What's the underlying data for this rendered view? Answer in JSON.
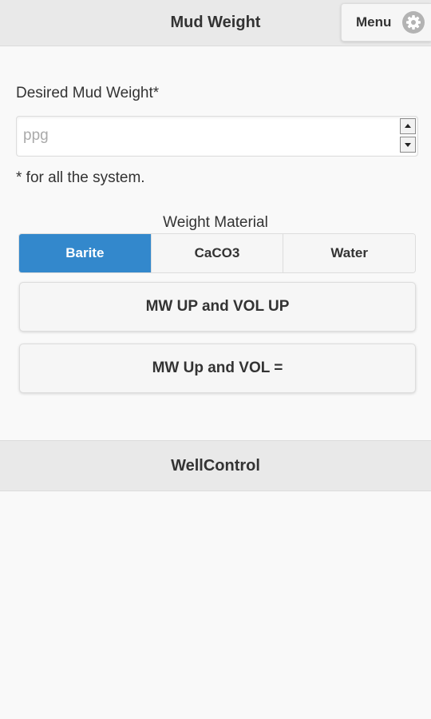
{
  "header": {
    "title": "Mud Weight",
    "menu_label": "Menu",
    "menu_icon": "gear-icon"
  },
  "form": {
    "field_label": "Desired Mud Weight*",
    "input_value": "",
    "input_placeholder": "ppg",
    "note": "* for all the system."
  },
  "weight_material": {
    "label": "Weight Material",
    "options": [
      "Barite",
      "CaCO3",
      "Water"
    ],
    "selected": "Barite"
  },
  "actions": {
    "mw_up_vol_up": "MW UP and VOL UP",
    "mw_up_vol_eq": "MW Up and VOL ="
  },
  "footer": {
    "title": "WellControl"
  },
  "colors": {
    "accent": "#3388cc",
    "header_bg": "#e9e9e9",
    "page_bg": "#f9f9f9"
  }
}
